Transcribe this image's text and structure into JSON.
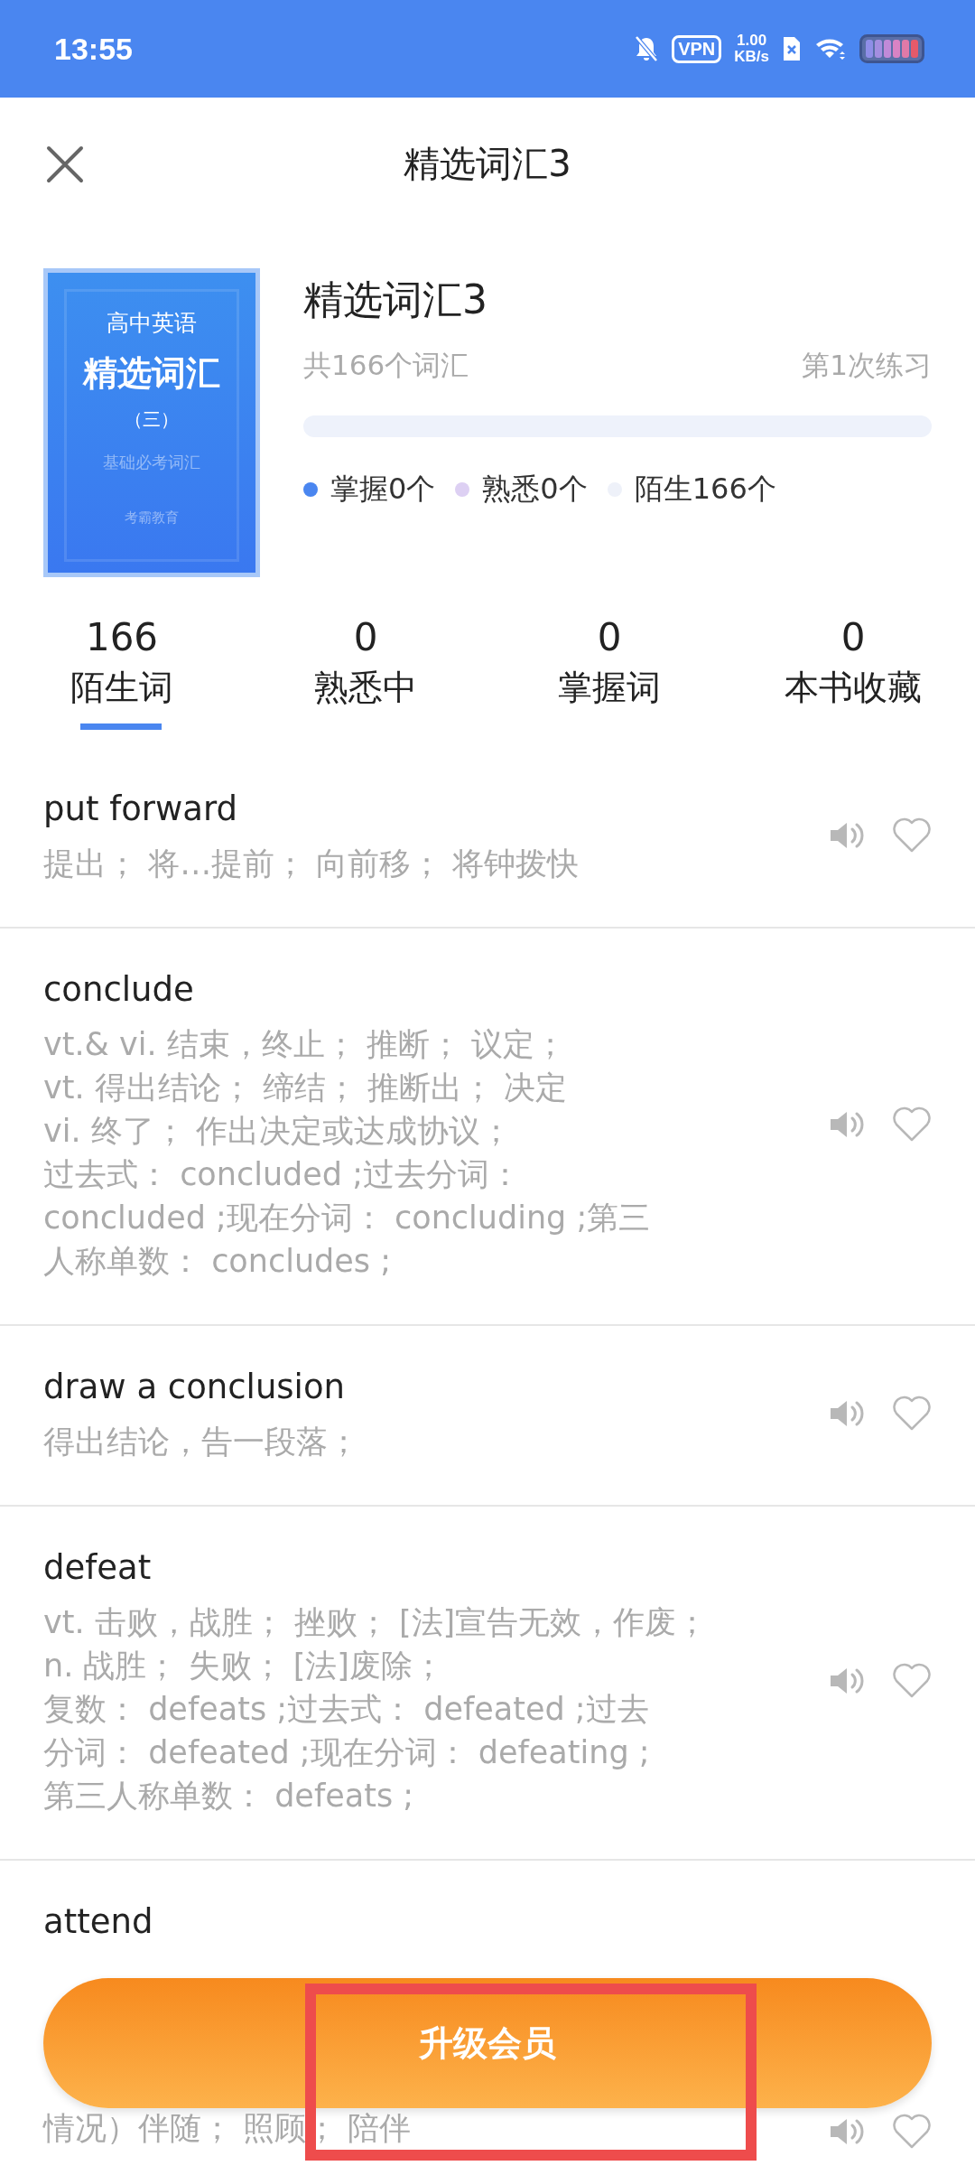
{
  "status_bar": {
    "time": "13:55",
    "vpn": "VPN",
    "speed_value": "1.00",
    "speed_unit": "KB/s"
  },
  "header": {
    "title": "精选词汇3"
  },
  "book": {
    "cover": {
      "subject": "高中英语",
      "title": "精选词汇",
      "volume": "（三）",
      "subtitle": "基础必考词汇",
      "publisher": "考霸教育"
    },
    "title": "精选词汇3",
    "count": "共166个词汇",
    "practice": "第1次练习",
    "level": 0,
    "legend": [
      {
        "label": "掌握0个",
        "color": "#4a86f0"
      },
      {
        "label": "熟悉0个",
        "color": "#ddd0f3"
      },
      {
        "label": "陌生166个",
        "color": "#eef1f9"
      }
    ]
  },
  "tabs": [
    {
      "count": "166",
      "label": "陌生词",
      "selected": true
    },
    {
      "count": "0",
      "label": "熟悉中",
      "selected": false
    },
    {
      "count": "0",
      "label": "掌握词",
      "selected": false
    },
    {
      "count": "0",
      "label": "本书收藏",
      "selected": false
    }
  ],
  "words": [
    {
      "word": "put forward",
      "lines": [
        "提出； 将…提前； 向前移； 将钟拨快"
      ]
    },
    {
      "word": "conclude",
      "lines": [
        "vt.& vi. 结束，终止； 推断； 议定；",
        "vt. 得出结论； 缔结； 推断出； 决定",
        "vi. 终了； 作出决定或达成协议；",
        "过去式： concluded ;过去分词：",
        "concluded ;现在分词： concluding ;第三",
        "人称单数： concludes ;"
      ]
    },
    {
      "word": "draw a conclusion",
      "lines": [
        "得出结论，告一段落；"
      ]
    },
    {
      "word": "defeat",
      "lines": [
        "vt. 击败，战胜； 挫败； [法]宣告无效，作废；",
        "n. 战胜； 失败； [法]废除；",
        "复数： defeats ;过去式： defeated ;过去",
        "分词： defeated ;现在分词： defeating ;",
        "第三人称单数： defeats ;"
      ]
    },
    {
      "word": "attend",
      "lines": [
        "情况）伴随； 照顾； 陪伴"
      ]
    }
  ],
  "upgrade_button": "升级会员"
}
